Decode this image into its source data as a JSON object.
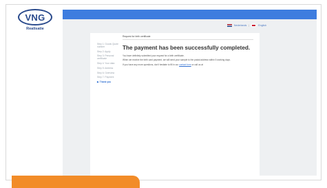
{
  "logo": {
    "text": "VNG",
    "subtitle": "Realisatie"
  },
  "language": {
    "dutch": "Nederlands",
    "english": "English",
    "separator": "|"
  },
  "breadcrumb": "Request for birth certificate",
  "steps": [
    {
      "label": "Step 1: Goods Quote number"
    },
    {
      "label": "Step 2: Apply"
    },
    {
      "label": "Step 3: Personal certificate"
    },
    {
      "label": "Step 4: Your data"
    },
    {
      "label": "Step 5: Address"
    },
    {
      "label": "Step 6: Overview"
    },
    {
      "label": "Step 7: Payment"
    },
    {
      "label": "Thank you",
      "active": true
    }
  ],
  "active_marker": "▶",
  "heading": "The payment has been successfully completed.",
  "body": {
    "p1": "You have definitely submitted your request for a birth certificate.",
    "p2": "When we receive the birth card payment, we will send your sample to the postal address within 5 working days.",
    "p3_pre": "If you have any more questions, don't hesitate to fill in our",
    "p3_link": "contact form",
    "p3_post": "or call us at"
  },
  "colors": {
    "top_bar": "#3e7ddf",
    "accent_orange": "#f28c28",
    "link_blue": "#2f6fd1",
    "logo_blue": "#2a4a8c"
  }
}
